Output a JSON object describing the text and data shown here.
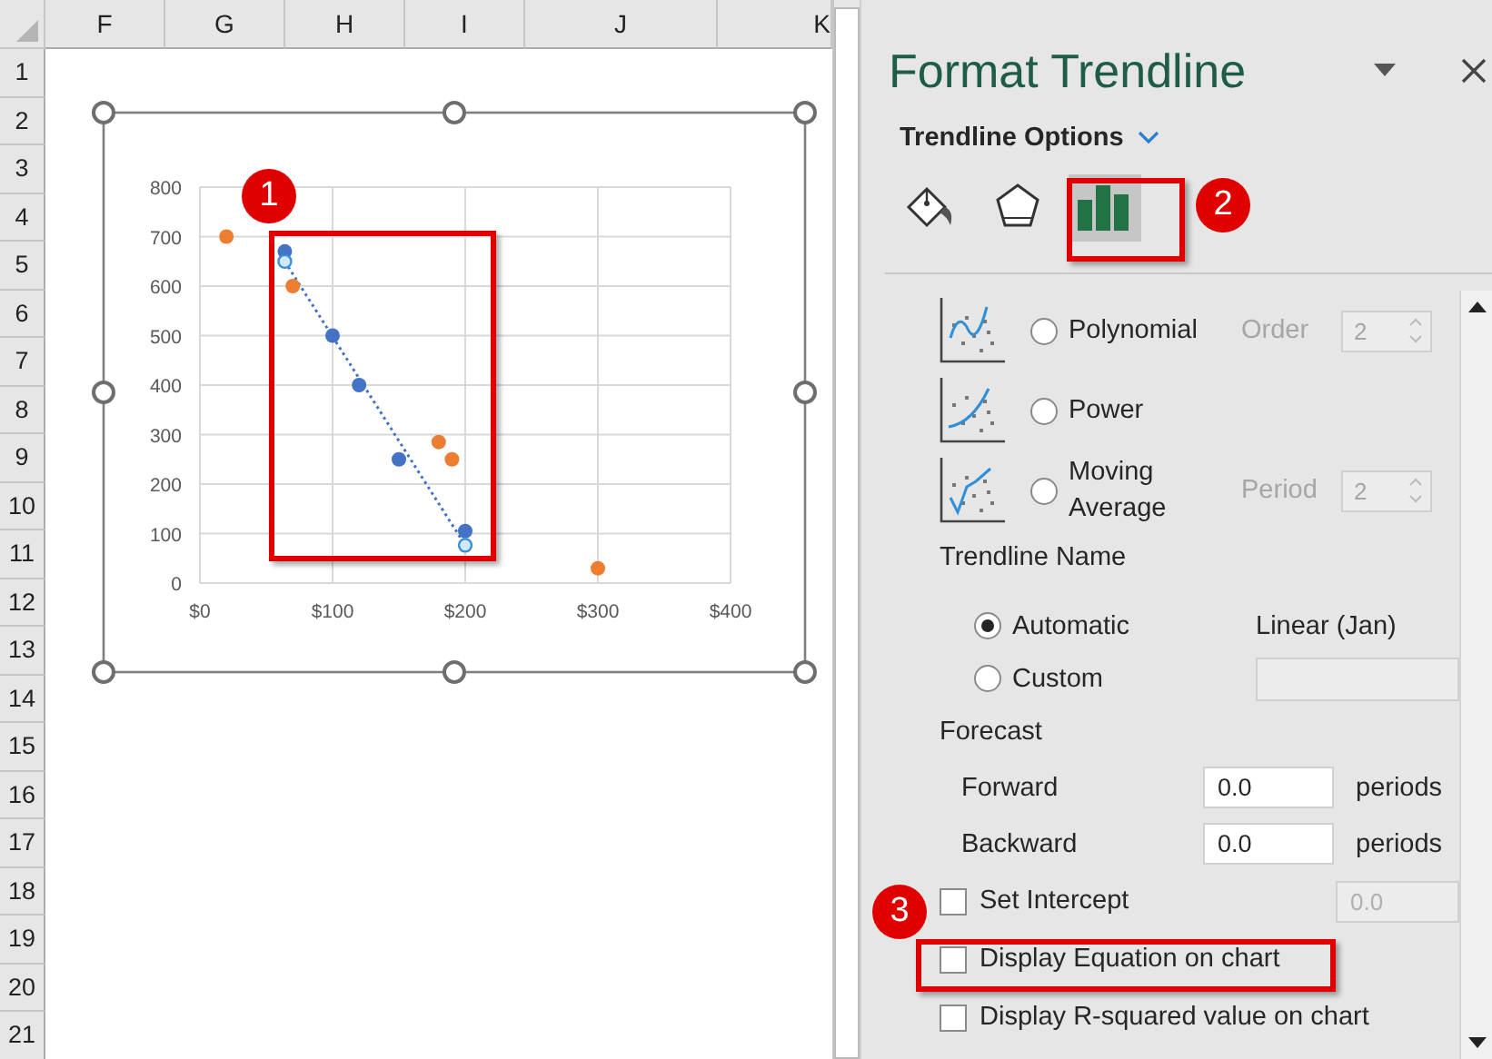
{
  "sheet": {
    "columns": [
      "F",
      "G",
      "H",
      "I",
      "J",
      "K"
    ],
    "rows": [
      "1",
      "2",
      "3",
      "4",
      "5",
      "6",
      "7",
      "8",
      "9",
      "10",
      "11",
      "12",
      "13",
      "14",
      "15",
      "16",
      "17",
      "18",
      "19",
      "20",
      "21"
    ]
  },
  "chart": {
    "chart_data": {
      "type": "scatter",
      "grid": true,
      "xlim": [
        0,
        400
      ],
      "ylim": [
        0,
        800
      ],
      "xticks": [
        {
          "value": 0,
          "label": "$0"
        },
        {
          "value": 100,
          "label": "$100"
        },
        {
          "value": 200,
          "label": "$200"
        },
        {
          "value": 300,
          "label": "$300"
        },
        {
          "value": 400,
          "label": "$400"
        }
      ],
      "yticks": [
        0,
        100,
        200,
        300,
        400,
        500,
        600,
        700,
        800
      ],
      "series": [
        {
          "color": "#4472c4",
          "x": [
            64,
            100,
            120,
            150,
            200
          ],
          "values": [
            670,
            500,
            400,
            250,
            105
          ]
        },
        {
          "color": "#ed7d31",
          "x": [
            20,
            70,
            180,
            190,
            300
          ],
          "values": [
            700,
            600,
            285,
            250,
            30
          ]
        }
      ]
    }
  },
  "panel": {
    "title": "Format Trendline",
    "section": "Trendline Options",
    "tabs": [
      {
        "kind": "fill",
        "selected": false
      },
      {
        "kind": "effects",
        "selected": false
      },
      {
        "kind": "options",
        "selected": true
      }
    ],
    "trendline_types": [
      {
        "kind": "polynomial",
        "label": "Polynomial",
        "selected": false,
        "param_label": "Order",
        "param_value": "2",
        "param_disabled": true
      },
      {
        "kind": "power",
        "label": "Power",
        "selected": false
      },
      {
        "kind": "moving_average",
        "label": "Moving Average",
        "selected": false,
        "param_label": "Period",
        "param_value": "2",
        "param_disabled": true
      }
    ],
    "trendline_name": {
      "heading": "Trendline Name",
      "options": [
        {
          "label": "Automatic",
          "selected": true,
          "value": "Linear (Jan)"
        },
        {
          "label": "Custom",
          "selected": false
        }
      ]
    },
    "forecast": {
      "heading": "Forecast",
      "rows": [
        {
          "label": "Forward",
          "value": "0.0",
          "unit": "periods"
        },
        {
          "label": "Backward",
          "value": "0.0",
          "unit": "periods"
        }
      ]
    },
    "checkboxes": [
      {
        "label": "Set Intercept",
        "checked": false,
        "value": "0.0",
        "value_disabled": true
      },
      {
        "label": "Display Equation on chart",
        "checked": false
      },
      {
        "label": "Display R-squared value on chart",
        "checked": false
      }
    ]
  },
  "callouts": [
    "1",
    "2",
    "3"
  ]
}
